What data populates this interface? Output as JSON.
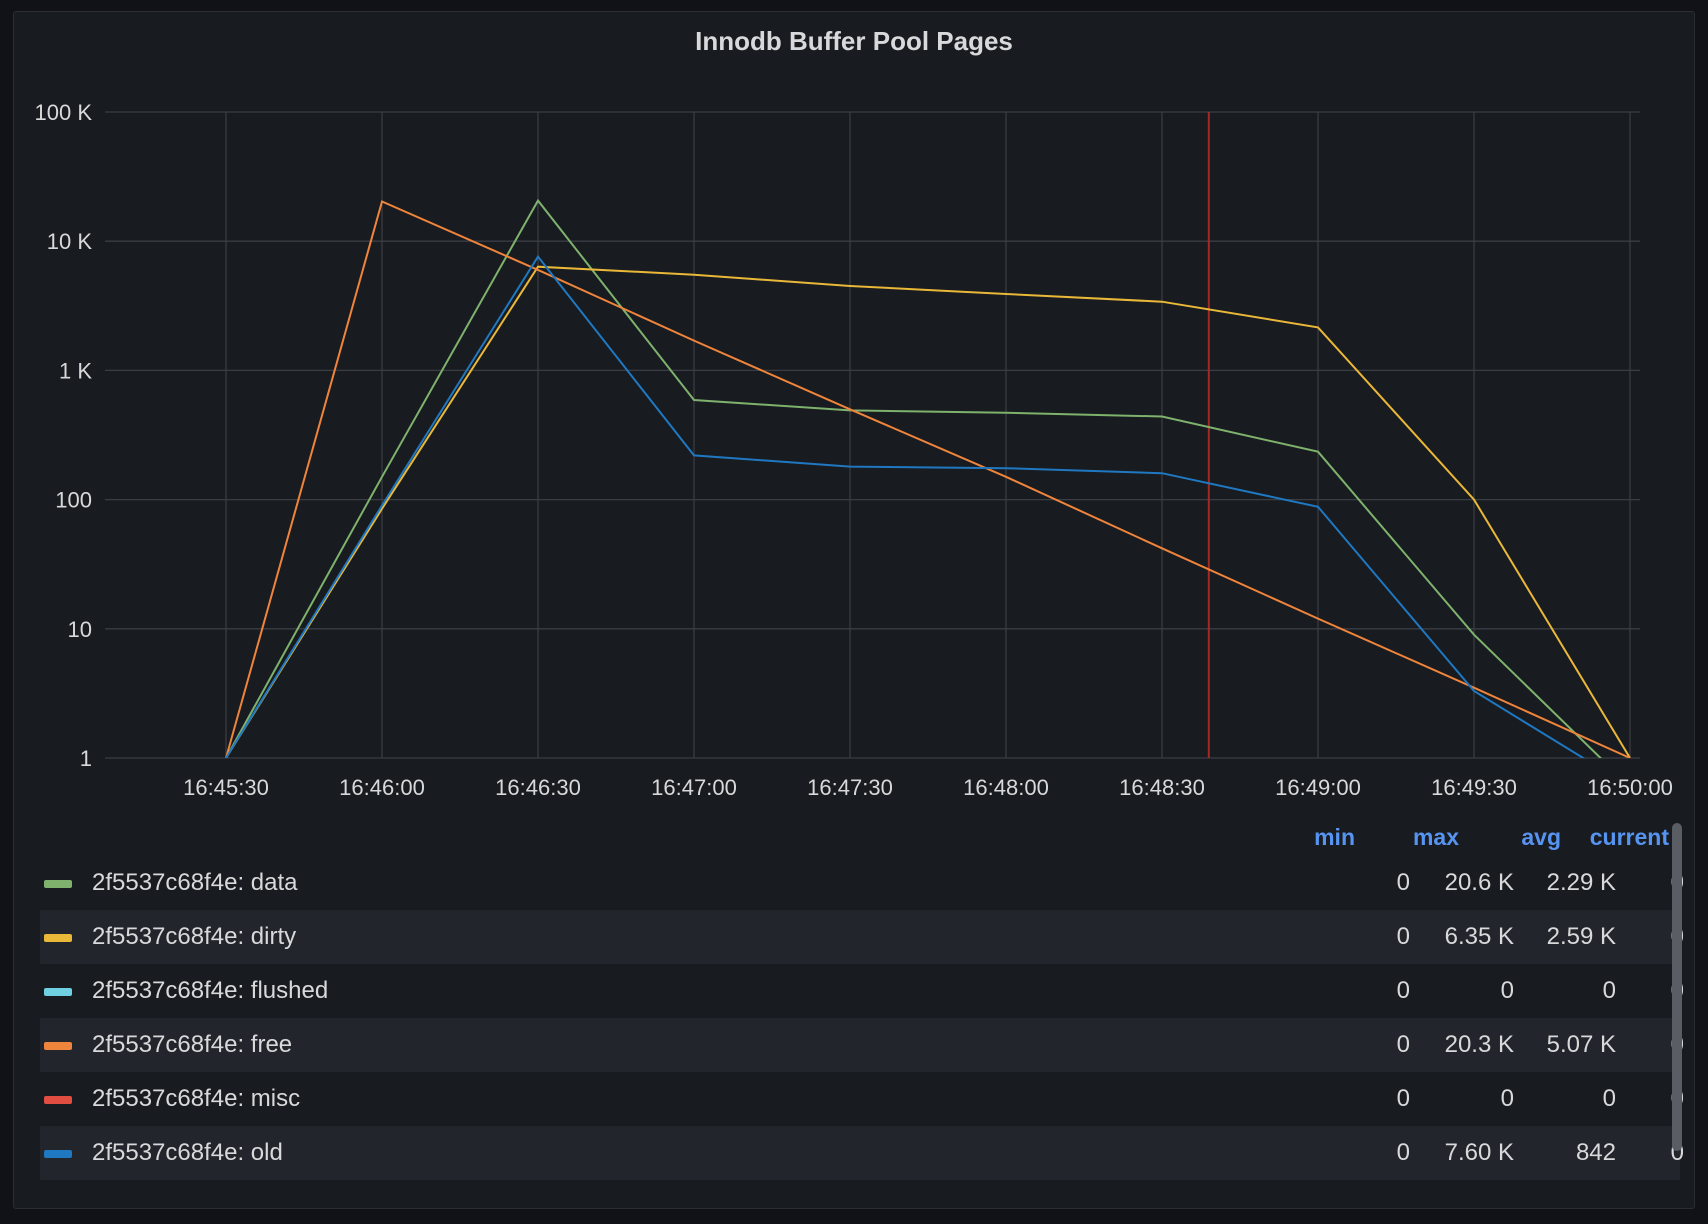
{
  "panel": {
    "title": "Innodb Buffer Pool Pages"
  },
  "chart_data": {
    "type": "line",
    "title": "Innodb Buffer Pool Pages",
    "y_scale": "log10",
    "ylim": [
      1,
      100000
    ],
    "y_ticks": [
      {
        "value": 1,
        "label": "1"
      },
      {
        "value": 10,
        "label": "10"
      },
      {
        "value": 100,
        "label": "100"
      },
      {
        "value": 1000,
        "label": "1 K"
      },
      {
        "value": 10000,
        "label": "10 K"
      },
      {
        "value": 100000,
        "label": "100 K"
      }
    ],
    "x": [
      "16:45:30",
      "16:46:00",
      "16:46:30",
      "16:47:00",
      "16:47:30",
      "16:48:00",
      "16:48:30",
      "16:49:00",
      "16:49:30",
      "16:50:00"
    ],
    "grid": true,
    "marker_line": {
      "time": "16:48:39",
      "color": "#a12b23"
    },
    "series": [
      {
        "name": "2f5537c68f4e: data",
        "color": "#7eb26d",
        "values": [
          1,
          150,
          20600,
          590,
          490,
          470,
          440,
          235,
          9,
          0.6
        ]
      },
      {
        "name": "2f5537c68f4e: dirty",
        "color": "#eab839",
        "values": [
          1,
          85,
          6350,
          5500,
          4500,
          3900,
          3400,
          2150,
          100,
          1
        ]
      },
      {
        "name": "2f5537c68f4e: flushed",
        "color": "#6ed0e0",
        "values": [
          0,
          0,
          0,
          0,
          0,
          0,
          0,
          0,
          0,
          0
        ]
      },
      {
        "name": "2f5537c68f4e: free",
        "color": "#ef843c",
        "values": [
          1,
          20300,
          6000,
          1700,
          500,
          150,
          42,
          12,
          3.5,
          1
        ]
      },
      {
        "name": "2f5537c68f4e: misc",
        "color": "#e24d42",
        "values": [
          0,
          0,
          0,
          0,
          0,
          0,
          0,
          0,
          0,
          0
        ]
      },
      {
        "name": "2f5537c68f4e: old",
        "color": "#1f78c1",
        "values": [
          1,
          90,
          7600,
          220,
          180,
          175,
          160,
          88,
          3.3,
          0.6
        ]
      }
    ]
  },
  "legend": {
    "headers": {
      "min": "min",
      "max": "max",
      "avg": "avg",
      "current": "current"
    },
    "rows": [
      {
        "name": "2f5537c68f4e: data",
        "color": "#7eb26d",
        "min": "0",
        "max": "20.6 K",
        "avg": "2.29 K",
        "current": "0"
      },
      {
        "name": "2f5537c68f4e: dirty",
        "color": "#eab839",
        "min": "0",
        "max": "6.35 K",
        "avg": "2.59 K",
        "current": "0"
      },
      {
        "name": "2f5537c68f4e: flushed",
        "color": "#6ed0e0",
        "min": "0",
        "max": "0",
        "avg": "0",
        "current": "0"
      },
      {
        "name": "2f5537c68f4e: free",
        "color": "#ef843c",
        "min": "0",
        "max": "20.3 K",
        "avg": "5.07 K",
        "current": "0"
      },
      {
        "name": "2f5537c68f4e: misc",
        "color": "#e24d42",
        "min": "0",
        "max": "0",
        "avg": "0",
        "current": "0"
      },
      {
        "name": "2f5537c68f4e: old",
        "color": "#1f78c1",
        "min": "0",
        "max": "7.60 K",
        "avg": "842",
        "current": "0"
      }
    ]
  }
}
